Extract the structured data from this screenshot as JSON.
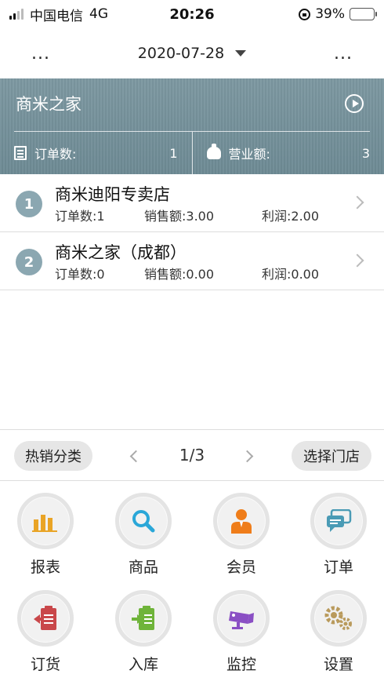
{
  "status_bar": {
    "carrier": "中国电信",
    "network": "4G",
    "time": "20:26",
    "battery_percent": "39%",
    "battery_level": 0.39
  },
  "nav": {
    "left_menu": "...",
    "date": "2020-07-28",
    "right_menu": "..."
  },
  "summary": {
    "store_title": "商米之家",
    "orders_label": "订单数:",
    "orders_value": "1",
    "revenue_label": "营业额:",
    "revenue_value": "3"
  },
  "stores": [
    {
      "rank": "1",
      "name": "商米迪阳专卖店",
      "orders": "订单数:1",
      "sales": "销售额:3.00",
      "profit": "利润:2.00"
    },
    {
      "rank": "2",
      "name": "商米之家（成都）",
      "orders": "订单数:0",
      "sales": "销售额:0.00",
      "profit": "利润:0.00"
    }
  ],
  "pager": {
    "hot_category": "热销分类",
    "page": "1/3",
    "select_store": "选择门店"
  },
  "menu": [
    {
      "label": "报表",
      "icon": "bar-chart-icon",
      "color": "#e9a426"
    },
    {
      "label": "商品",
      "icon": "search-icon",
      "color": "#2aa7d8"
    },
    {
      "label": "会员",
      "icon": "member-icon",
      "color": "#ef7d1a"
    },
    {
      "label": "订单",
      "icon": "chat-icon",
      "color": "#4a9bb5"
    },
    {
      "label": "订货",
      "icon": "clipboard-out-icon",
      "color": "#c9474a"
    },
    {
      "label": "入库",
      "icon": "clipboard-in-icon",
      "color": "#6fb43a"
    },
    {
      "label": "监控",
      "icon": "camera-icon",
      "color": "#8a4fc4"
    },
    {
      "label": "设置",
      "icon": "gears-icon",
      "color": "#b99a5c"
    }
  ]
}
